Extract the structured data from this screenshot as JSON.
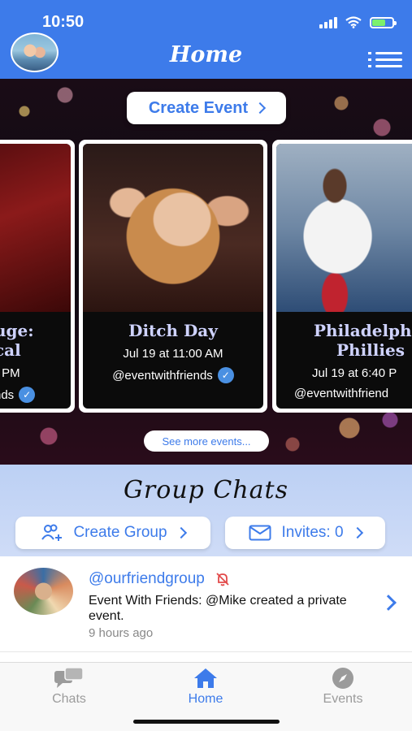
{
  "status_bar": {
    "time": "10:50"
  },
  "header": {
    "title": "Home",
    "avatar_icon": "user-avatar",
    "menu_icon": "menu-icon"
  },
  "events": {
    "create_button": "Create Event",
    "cards": [
      {
        "name_line1": "uge:",
        "name_line2": "cal",
        "date": ") PM",
        "host": "nds"
      },
      {
        "name_line1": "Ditch Day",
        "name_line2": "",
        "date": "Jul 19 at 11:00 AM",
        "host": "@eventwithfriends"
      },
      {
        "name_line1": "Philadelphi",
        "name_line2": "Phillies",
        "date": "Jul 19 at 6:40 P",
        "host": "@eventwithfriend"
      }
    ],
    "see_more": "See more events..."
  },
  "groups": {
    "title": "Group Chats",
    "create_button": "Create Group",
    "invites_button": "Invites: 0"
  },
  "chat": {
    "handle": "@ourfriendgroup",
    "message": "Event With Friends: @Mike created a private event.",
    "time": "9 hours ago"
  },
  "tabs": [
    {
      "label": "Chats",
      "icon": "chats-icon"
    },
    {
      "label": "Home",
      "icon": "home-icon"
    },
    {
      "label": "Events",
      "icon": "compass-icon"
    }
  ],
  "colors": {
    "accent": "#3d7bea",
    "group_bg": "#bcd0f4",
    "tab_inactive": "#9b9b9b"
  }
}
